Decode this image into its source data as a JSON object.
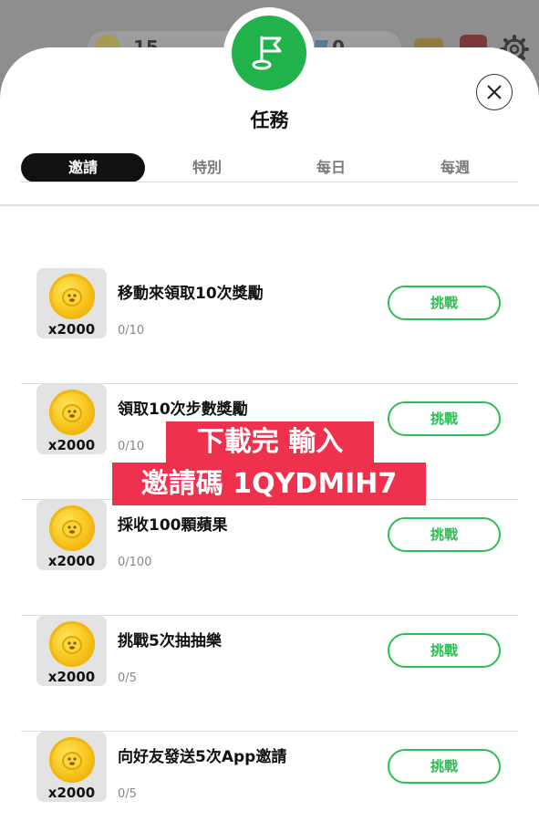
{
  "background": {
    "coins_count": "15",
    "gems_count": "0"
  },
  "modal": {
    "title": "任務"
  },
  "tabs": [
    {
      "label": "邀請",
      "active": true
    },
    {
      "label": "特別",
      "active": false
    },
    {
      "label": "每日",
      "active": false
    },
    {
      "label": "每週",
      "active": false
    }
  ],
  "missions": [
    {
      "title": "移動來領取10次獎勵",
      "progress": "0/10",
      "reward": "x2000",
      "button": "挑戰"
    },
    {
      "title": "領取10次步數獎勵",
      "progress": "0/10",
      "reward": "x2000",
      "button": "挑戰"
    },
    {
      "title": "採收100顆蘋果",
      "progress": "0/100",
      "reward": "x2000",
      "button": "挑戰"
    },
    {
      "title": "挑戰5次抽抽樂",
      "progress": "0/5",
      "reward": "x2000",
      "button": "挑戰"
    },
    {
      "title": "向好友發送5次App邀請",
      "progress": "0/5",
      "reward": "x2000",
      "button": "挑戰"
    }
  ],
  "promo": {
    "line1": "下載完 輸入",
    "line2": "邀請碼 1QYDMIH7"
  },
  "colors": {
    "accent_green": "#2fbd55",
    "flag_green": "#22b24c",
    "promo_red": "#f0314d",
    "coin_gold": "#f6c219"
  },
  "icons": {
    "header": "flag-icon",
    "close": "close-icon",
    "reward": "coin-icon",
    "settings": "gear-icon"
  }
}
